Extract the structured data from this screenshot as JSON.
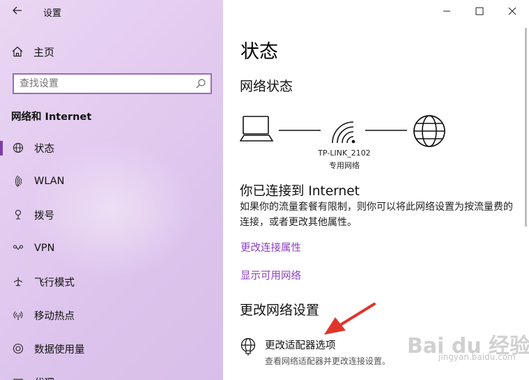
{
  "window": {
    "title": "设置",
    "controls": {
      "minimize_icon": "minimize-icon",
      "maximize_icon": "maximize-icon",
      "close_icon": "close-icon"
    }
  },
  "sidebar": {
    "home_label": "主页",
    "search": {
      "placeholder": "查找设置",
      "value": ""
    },
    "section_title": "网络和 Internet",
    "items": [
      {
        "label": "状态",
        "icon": "globe-status-icon",
        "selected": true
      },
      {
        "label": "WLAN",
        "icon": "wifi-icon",
        "selected": false
      },
      {
        "label": "拨号",
        "icon": "dialup-icon",
        "selected": false
      },
      {
        "label": "VPN",
        "icon": "vpn-icon",
        "selected": false
      },
      {
        "label": "飞行模式",
        "icon": "airplane-icon",
        "selected": false
      },
      {
        "label": "移动热点",
        "icon": "hotspot-icon",
        "selected": false
      },
      {
        "label": "数据使用量",
        "icon": "data-usage-icon",
        "selected": false
      },
      {
        "label": "代理",
        "icon": "proxy-icon",
        "selected": false
      }
    ],
    "accent": "#7b3fa8"
  },
  "main": {
    "page_title": "状态",
    "network_status_title": "网络状态",
    "network": {
      "name": "TP-LINK_2102",
      "type": "专用网络"
    },
    "connected_title": "你已连接到 Internet",
    "description": "如果你的流量套餐有限制，则你可以将此网络设置为按流量费的连接，或者更改其他属性。",
    "links": [
      {
        "label": "更改连接属性"
      },
      {
        "label": "显示可用网络"
      }
    ],
    "change_settings_title": "更改网络设置",
    "adapter_option": {
      "title": "更改适配器选项",
      "subtitle": "查看网络适配器并更改连接设置。"
    },
    "link_color": "#8e3fbf"
  },
  "annotation": {
    "arrow_color": "#e0352b"
  },
  "watermark": {
    "main": "Bai du 经验",
    "sub": "jingyan.baidu.com"
  }
}
